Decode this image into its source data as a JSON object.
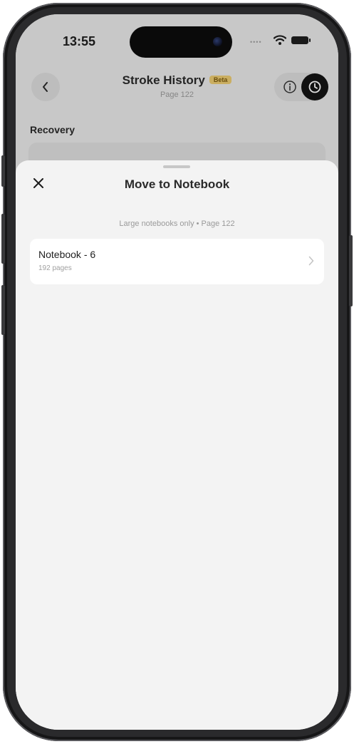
{
  "status_bar": {
    "time": "13:55"
  },
  "header": {
    "title": "Stroke History",
    "badge": "Beta",
    "subtitle": "Page 122"
  },
  "background": {
    "section_label": "Recovery"
  },
  "sheet": {
    "title": "Move to Notebook",
    "subtitle": "Large notebooks only • Page 122",
    "notebooks": [
      {
        "name": "Notebook - 6",
        "pages": "192 pages"
      }
    ]
  },
  "icons": {
    "back": "chevron-left-icon",
    "info": "info-icon",
    "history": "clock-icon",
    "close": "close-icon",
    "row": "chevron-right-icon"
  },
  "colors": {
    "badge_bg": "#e8c870",
    "sheet_bg": "#f3f3f3",
    "row_bg": "#ffffff",
    "clock_btn_bg": "#141414"
  }
}
